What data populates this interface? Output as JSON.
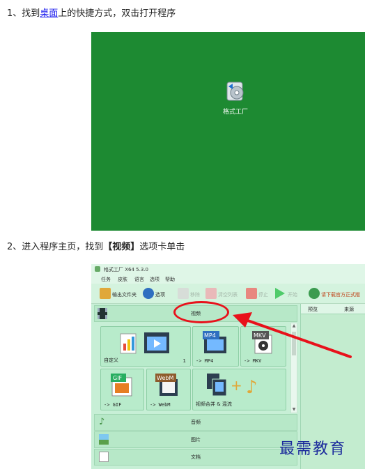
{
  "steps": [
    {
      "number_prefix": "1、找到",
      "link": "桌面",
      "suffix": "上的快捷方式，双击打开程序"
    },
    {
      "text_before": "2、进入程序主页，找到",
      "bold": "【视频】",
      "text_after": "选项卡单击"
    }
  ],
  "desktop": {
    "icon_label": "格式工厂",
    "background": "#1d8a32"
  },
  "app": {
    "title": "格式工厂 X64 5.3.0",
    "menu": [
      "任务",
      "皮肤",
      "语言",
      "选项",
      "帮助"
    ],
    "toolbar": {
      "output_folder": "输出文件夹",
      "options": "选项",
      "remove": "移除",
      "clear_list": "清空列表",
      "stop": "停止",
      "start": "开始",
      "download": "请下载官方正式版"
    },
    "category_video": "视频",
    "tiles": [
      {
        "label": "自定义",
        "badge": "1"
      },
      {
        "label": "-> MP4",
        "icon_text": "MP4"
      },
      {
        "label": "-> MKV",
        "icon_text": "MKV"
      },
      {
        "label": "-> GIF",
        "icon_text": "GIF"
      },
      {
        "label": "-> WebM",
        "icon_text": "WebM"
      },
      {
        "label": "视频合并 & 混流"
      }
    ],
    "categories": [
      "音频",
      "图片",
      "文档"
    ],
    "right_panel": {
      "col1": "预览",
      "col2": "来源"
    }
  },
  "watermark": "最需教育",
  "colors": {
    "highlight": "#e8111b",
    "app_bg": "#c7efd6",
    "link": "#1a1aee"
  }
}
